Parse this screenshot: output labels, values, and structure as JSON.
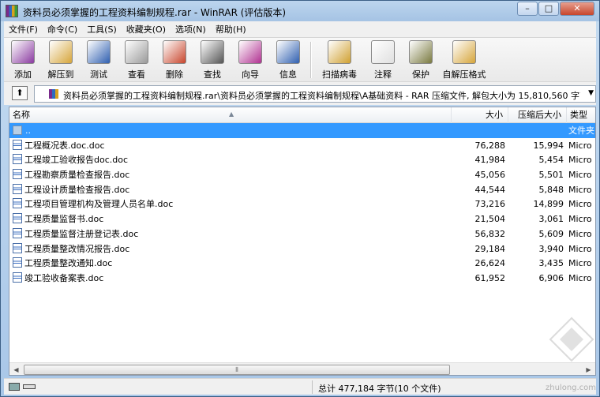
{
  "window": {
    "title": "资料员必须掌握的工程资料编制规程.rar - WinRAR (评估版本)",
    "controls": {
      "minimize": "–",
      "maximize": "□",
      "close": "✕"
    }
  },
  "menu": [
    "文件(F)",
    "命令(C)",
    "工具(S)",
    "收藏夹(O)",
    "选项(N)",
    "帮助(H)"
  ],
  "toolbar": [
    {
      "label": "添加",
      "icon": "add-icon",
      "color": "#8a3aa0"
    },
    {
      "label": "解压到",
      "icon": "extract-icon",
      "color": "#d6a53a"
    },
    {
      "label": "测试",
      "icon": "test-icon",
      "color": "#2f5fb0"
    },
    {
      "label": "查看",
      "icon": "view-icon",
      "color": "#9a9a9a"
    },
    {
      "label": "删除",
      "icon": "delete-icon",
      "color": "#c8452c"
    },
    {
      "label": "查找",
      "icon": "find-icon",
      "color": "#555555"
    },
    {
      "label": "向导",
      "icon": "wizard-icon",
      "color": "#b03090"
    },
    {
      "label": "信息",
      "icon": "info-icon",
      "color": "#2f5fb0"
    },
    {
      "label": "扫描病毒",
      "icon": "virus-scan-icon",
      "color": "#d0a030"
    },
    {
      "label": "注释",
      "icon": "comment-icon",
      "color": "#e0e0e0"
    },
    {
      "label": "保护",
      "icon": "protect-icon",
      "color": "#7a7a40"
    },
    {
      "label": "自解压格式",
      "icon": "sfx-icon",
      "color": "#d6a53a"
    }
  ],
  "address": {
    "up_label": "⬆",
    "path": "资料员必须掌握的工程资料编制规程.rar\\资料员必须掌握的工程资料编制规程\\A基础资料 - RAR 压缩文件, 解包大小为 15,810,560 字节",
    "dropdown": "▼"
  },
  "columns": {
    "name": "名称",
    "size": "大小",
    "packed": "压缩后大小",
    "type": "类型",
    "sort_arrow": "▲"
  },
  "parent_row": {
    "name": "..",
    "type": "文件夹"
  },
  "files": [
    {
      "name": "工程概况表.doc.doc",
      "size": "76,288",
      "packed": "15,994",
      "type": "Micro"
    },
    {
      "name": "工程竣工验收报告doc.doc",
      "size": "41,984",
      "packed": "5,454",
      "type": "Micro"
    },
    {
      "name": "工程勘察质量检查报告.doc",
      "size": "45,056",
      "packed": "5,501",
      "type": "Micro"
    },
    {
      "name": "工程设计质量检查报告.doc",
      "size": "44,544",
      "packed": "5,848",
      "type": "Micro"
    },
    {
      "name": "工程项目管理机构及管理人员名单.doc",
      "size": "73,216",
      "packed": "14,899",
      "type": "Micro"
    },
    {
      "name": "工程质量监督书.doc",
      "size": "21,504",
      "packed": "3,061",
      "type": "Micro"
    },
    {
      "name": "工程质量监督注册登记表.doc",
      "size": "56,832",
      "packed": "5,609",
      "type": "Micro"
    },
    {
      "name": "工程质量整改情况报告.doc",
      "size": "29,184",
      "packed": "3,940",
      "type": "Micro"
    },
    {
      "name": "工程质量整改通知.doc",
      "size": "26,624",
      "packed": "3,435",
      "type": "Micro"
    },
    {
      "name": "竣工验收备案表.doc",
      "size": "61,952",
      "packed": "6,906",
      "type": "Micro"
    }
  ],
  "scrollbar": {
    "left": "◀",
    "right": "▶",
    "grip": "⦀"
  },
  "status": {
    "summary": "总计 477,184 字节(10 个文件)"
  },
  "watermark": "zhulong.com"
}
